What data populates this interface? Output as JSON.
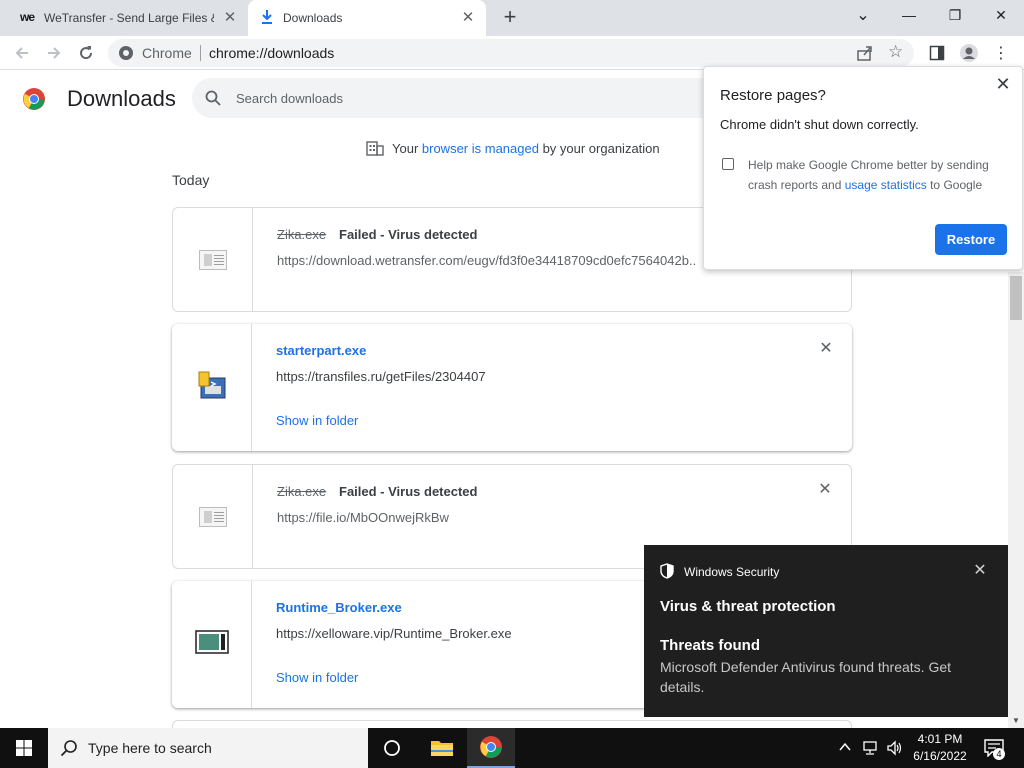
{
  "browser": {
    "tabs": [
      {
        "title": "WeTransfer - Send Large Files & Share Photos Online",
        "favicon": "wetransfer-logo"
      },
      {
        "title": "Downloads",
        "favicon": "download-icon"
      }
    ],
    "new_tab_label": "+",
    "window_controls": {
      "collapse": "⌄",
      "minimize": "—",
      "restore": "❐",
      "close": "✕"
    }
  },
  "toolbar": {
    "origin_label": "Chrome",
    "url": "chrome://downloads"
  },
  "downloads": {
    "title": "Downloads",
    "search_placeholder": "Search downloads",
    "managed": {
      "prefix": "Your ",
      "link": "browser is managed",
      "suffix": " by your organization"
    },
    "section_label": "Today",
    "items": [
      {
        "filename": "Zika.exe",
        "status": "Failed - Virus detected",
        "url": "https://download.wetransfer.com/eugv/fd3f0e34418709cd0efc7564042b..."
      },
      {
        "filename": "starterpart.exe",
        "url": "https://transfiles.ru/getFiles/2304407",
        "action": "Show in folder"
      },
      {
        "filename": "Zika.exe",
        "status": "Failed - Virus detected",
        "url": "https://file.io/MbOOnwejRkBw"
      },
      {
        "filename": "Runtime_Broker.exe",
        "url": "https://xelloware.vip/Runtime_Broker.exe",
        "action": "Show in folder"
      }
    ]
  },
  "restore_popup": {
    "title": "Restore pages?",
    "message": "Chrome didn't shut down correctly.",
    "help_prefix": "Help make Google Chrome better by sending crash reports and ",
    "help_link": "usage statistics",
    "help_suffix": " to Google",
    "button": "Restore",
    "checked": false
  },
  "toast": {
    "app": "Windows Security",
    "title": "Virus & threat protection",
    "subtitle": "Threats found",
    "body": "Microsoft Defender Antivirus found threats. Get details."
  },
  "taskbar": {
    "search_placeholder": "Type here to search",
    "time": "4:01 PM",
    "date": "6/16/2022",
    "notification_count": "4"
  },
  "colors": {
    "accent": "#1a73e8",
    "tabstrip": "#dee1e6",
    "toast_bg": "#1f1f1f",
    "taskbar_bg": "#101010"
  }
}
